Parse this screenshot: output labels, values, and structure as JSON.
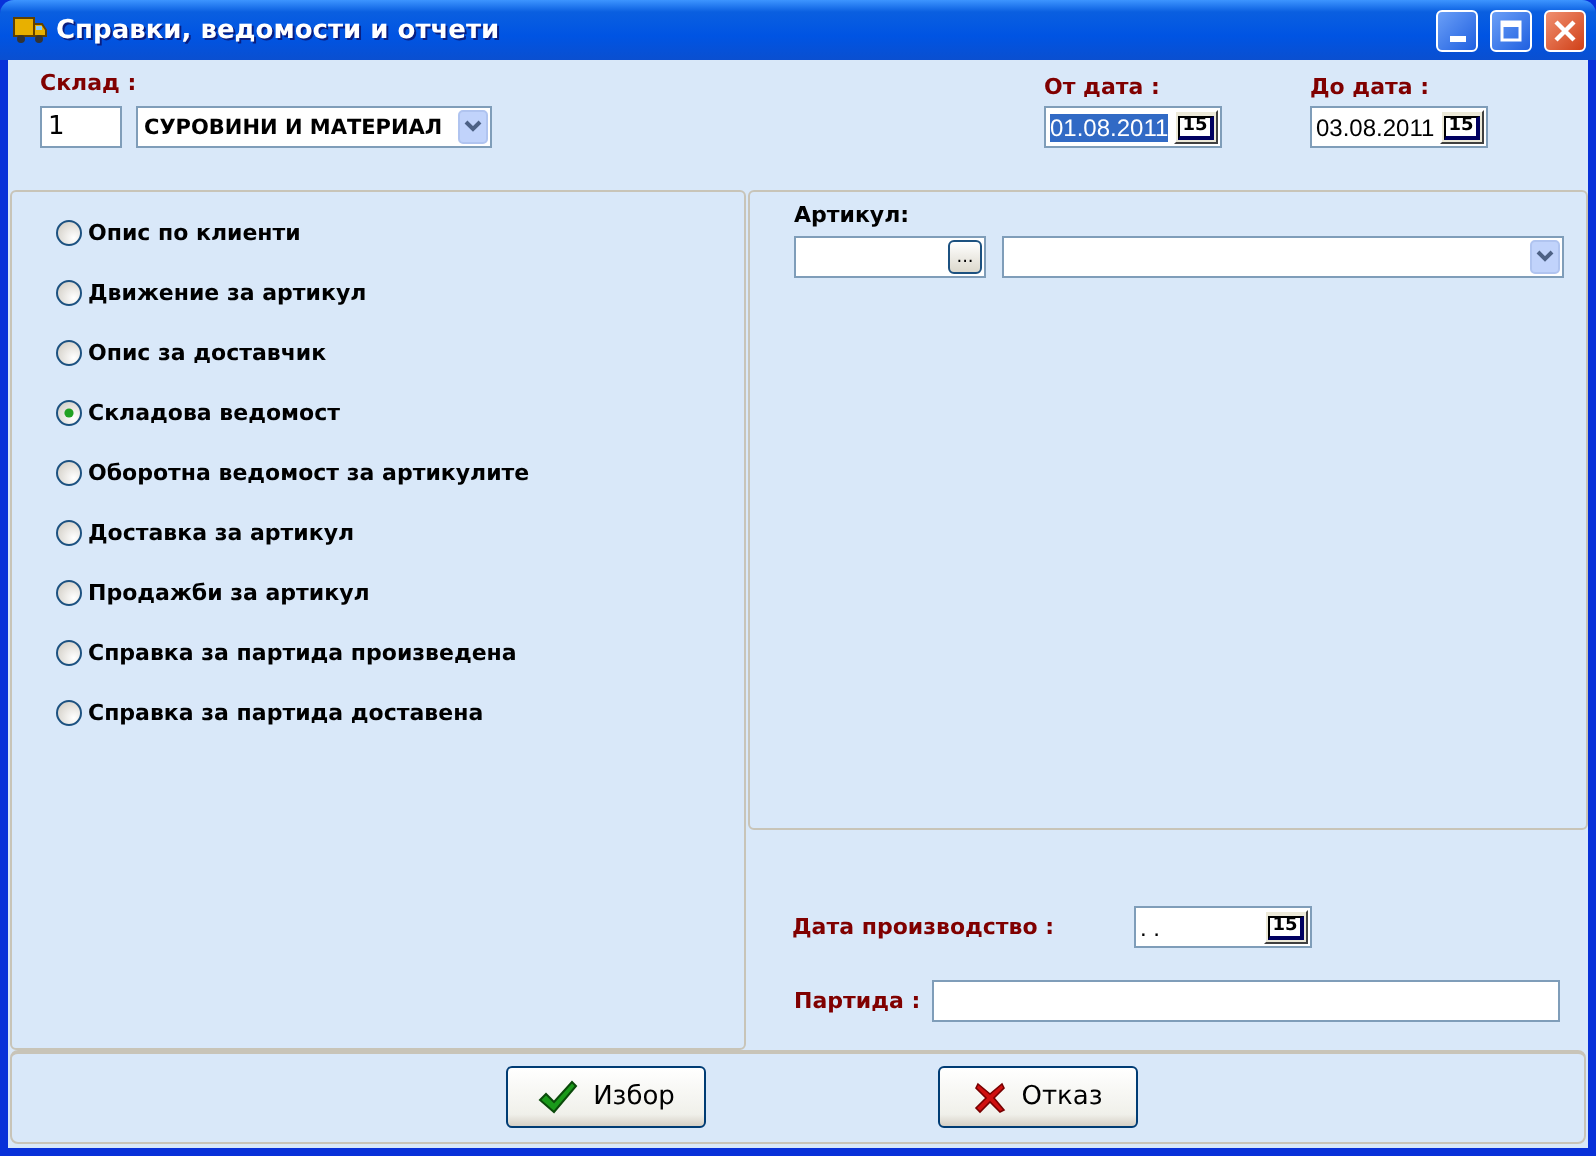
{
  "window": {
    "title": "Справки, ведомости и отчети"
  },
  "warehouse": {
    "label": "Склад :",
    "code": "1",
    "name": "СУРОВИНИ И МАТЕРИАЛ"
  },
  "from_date": {
    "label": "От дата :",
    "value": "01.08.2011",
    "highlighted": true,
    "button_label": "15"
  },
  "to_date": {
    "label": "До дата :",
    "value": "03.08.2011",
    "highlighted": false,
    "button_label": "15"
  },
  "reports": [
    {
      "label": "Опис по клиенти",
      "selected": false
    },
    {
      "label": "Движение за артикул",
      "selected": false
    },
    {
      "label": "Опис за доставчик",
      "selected": false
    },
    {
      "label": "Складова ведомост",
      "selected": true
    },
    {
      "label": "Оборотна ведомост за артикулите",
      "selected": false
    },
    {
      "label": "Доставка за артикул",
      "selected": false
    },
    {
      "label": "Продажби за артикул",
      "selected": false
    },
    {
      "label": "Справка за партида произведена",
      "selected": false
    },
    {
      "label": "Справка за партида доставена",
      "selected": false
    }
  ],
  "article": {
    "label": "Артикул:",
    "lookup_button_label": "..."
  },
  "production_date": {
    "label": "Дата производство :",
    "value": ". .",
    "highlighted": false,
    "button_label": "15"
  },
  "batch": {
    "label": "Партида :"
  },
  "buttons": [
    {
      "label": "Избор",
      "kind": "ok"
    },
    {
      "label": "Отказ",
      "kind": "cancel"
    }
  ]
}
